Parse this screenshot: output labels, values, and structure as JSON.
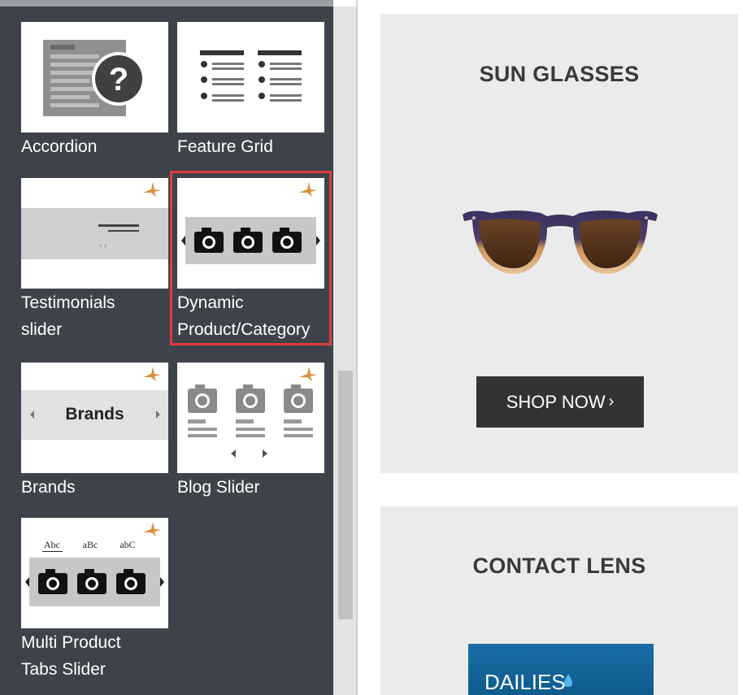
{
  "widgets": {
    "accordion": {
      "label": "Accordion",
      "icon": "accordion-question-icon"
    },
    "feature_grid": {
      "label": "Feature Grid",
      "icon": "feature-list-icon"
    },
    "testimonials": {
      "label_line1": "Testimonials",
      "label_line2": "slider",
      "icon": "testimonial-slider-icon"
    },
    "dynamic_product": {
      "label_line1": "Dynamic",
      "label_line2": "Product/Category",
      "icon": "camera-slider-icon",
      "selected": true
    },
    "brands": {
      "label": "Brands",
      "thumb_text": "Brands",
      "icon": "brands-slider-icon"
    },
    "blog_slider": {
      "label": "Blog Slider",
      "icon": "blog-slider-icon"
    },
    "multi_product": {
      "label_line1": "Multi Product",
      "label_line2": "Tabs Slider",
      "tabs": [
        "Abc",
        "aBc",
        "abC"
      ],
      "icon": "tabbed-camera-slider-icon"
    }
  },
  "preview": {
    "sun_glasses": {
      "title": "SUN GLASSES",
      "button_label": "SHOP NOW",
      "button_icon": "chevron-right-icon"
    },
    "contact_lens": {
      "title": "CONTACT LENS",
      "product_text": "DAILIES"
    }
  },
  "colors": {
    "panel_bg": "#3e434b",
    "selection_border": "#e03c3c",
    "pro_badge": "#d9913a",
    "card_bg": "#ebebeb",
    "button_bg": "#333333"
  }
}
